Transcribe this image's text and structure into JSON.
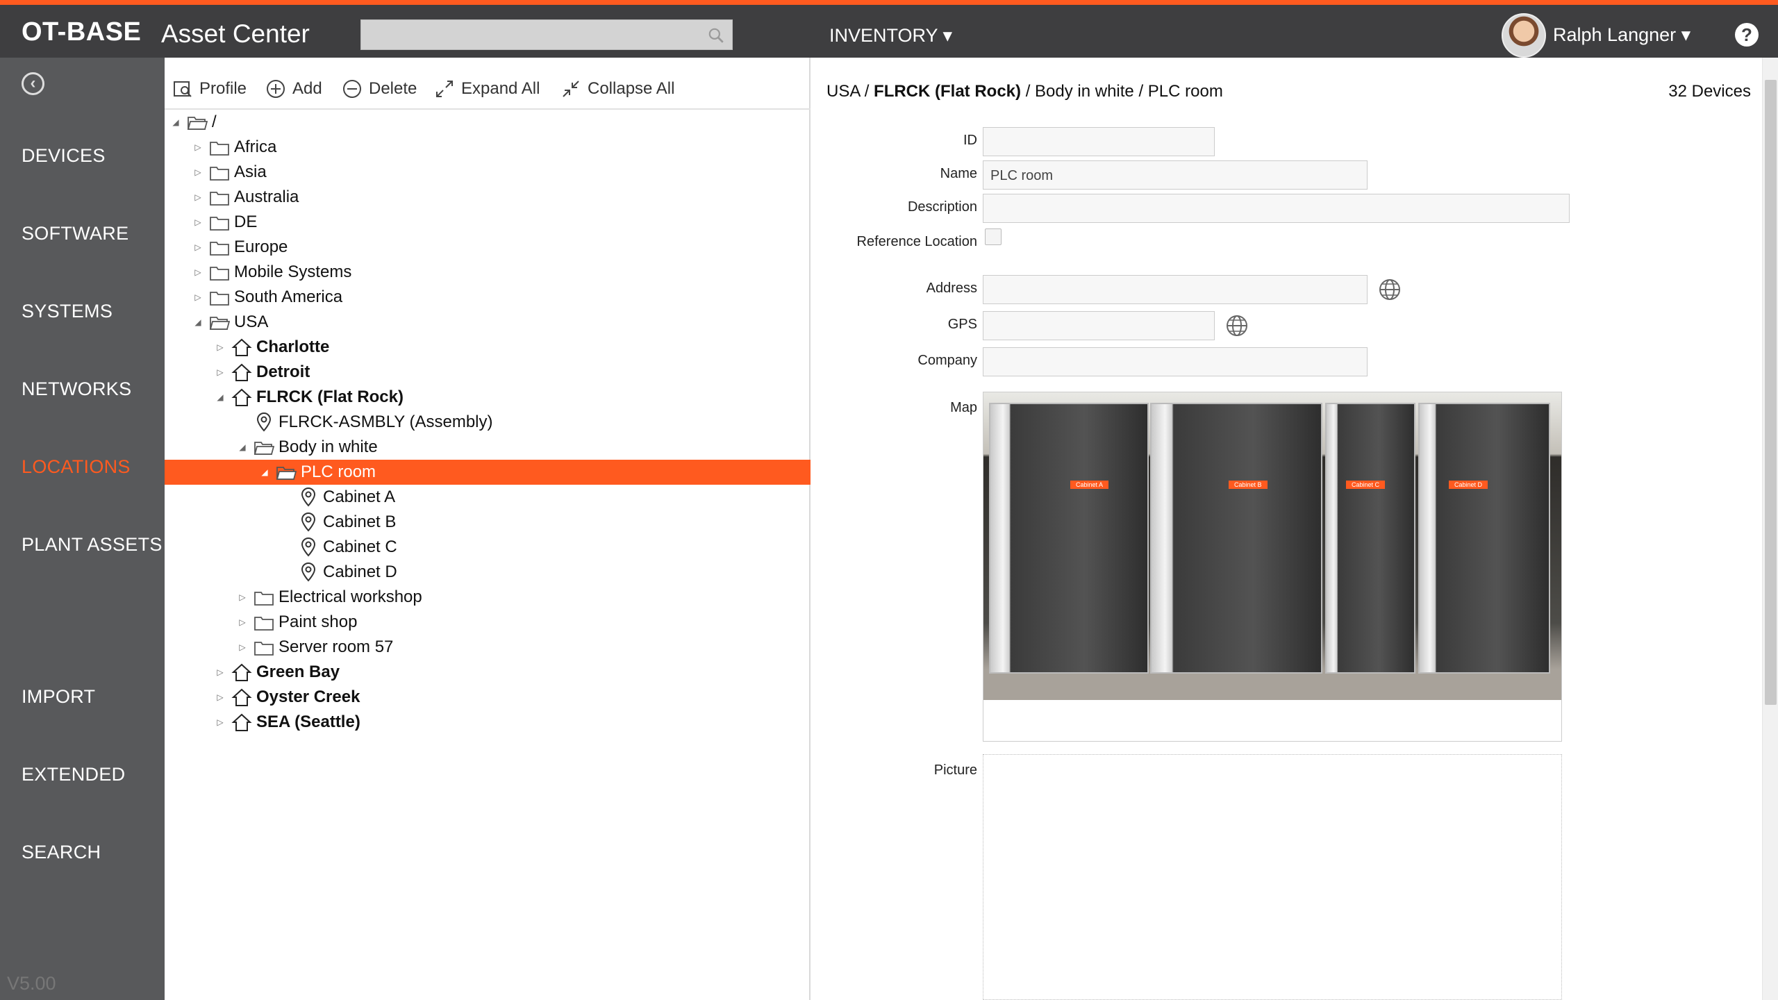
{
  "header": {
    "logo": "OT-BASE",
    "app_title": "Asset Center",
    "search_placeholder": "",
    "inventory_label": "INVENTORY ▾",
    "user_name": "Ralph Langner ▾",
    "help_label": "?"
  },
  "sidebar": {
    "items": [
      {
        "label": "DEVICES",
        "active": false
      },
      {
        "label": "SOFTWARE",
        "active": false
      },
      {
        "label": "SYSTEMS",
        "active": false
      },
      {
        "label": "NETWORKS",
        "active": false
      },
      {
        "label": "LOCATIONS",
        "active": true
      },
      {
        "label": "PLANT ASSETS",
        "active": false
      },
      {
        "label": "IMPORT",
        "active": false
      },
      {
        "label": "EXTENDED",
        "active": false
      },
      {
        "label": "SEARCH",
        "active": false
      }
    ],
    "version": "V5.00"
  },
  "toolbar": {
    "profile": "Profile",
    "add": "Add",
    "delete": "Delete",
    "expand_all": "Expand All",
    "collapse_all": "Collapse All"
  },
  "tree": [
    {
      "label": "/",
      "depth": 0,
      "expander": "expanded",
      "icon": "folder-open-icon",
      "bold": false
    },
    {
      "label": "Africa",
      "depth": 1,
      "expander": "collapsed",
      "icon": "folder-icon",
      "bold": false
    },
    {
      "label": "Asia",
      "depth": 1,
      "expander": "collapsed",
      "icon": "folder-icon",
      "bold": false
    },
    {
      "label": "Australia",
      "depth": 1,
      "expander": "collapsed",
      "icon": "folder-icon",
      "bold": false
    },
    {
      "label": "DE",
      "depth": 1,
      "expander": "collapsed",
      "icon": "folder-icon",
      "bold": false
    },
    {
      "label": "Europe",
      "depth": 1,
      "expander": "collapsed",
      "icon": "folder-icon",
      "bold": false
    },
    {
      "label": "Mobile Systems",
      "depth": 1,
      "expander": "collapsed",
      "icon": "folder-icon",
      "bold": false
    },
    {
      "label": "South America",
      "depth": 1,
      "expander": "collapsed",
      "icon": "folder-icon",
      "bold": false
    },
    {
      "label": "USA",
      "depth": 1,
      "expander": "expanded",
      "icon": "folder-open-icon",
      "bold": false
    },
    {
      "label": "Charlotte",
      "depth": 2,
      "expander": "collapsed",
      "icon": "site-icon",
      "bold": true
    },
    {
      "label": "Detroit",
      "depth": 2,
      "expander": "collapsed",
      "icon": "site-icon",
      "bold": true
    },
    {
      "label": "FLRCK (Flat Rock)",
      "depth": 2,
      "expander": "expanded",
      "icon": "site-icon",
      "bold": true
    },
    {
      "label": "FLRCK-ASMBLY (Assembly)",
      "depth": 3,
      "expander": "none",
      "icon": "pin-icon",
      "bold": false
    },
    {
      "label": "Body in white",
      "depth": 3,
      "expander": "expanded",
      "icon": "folder-open-icon",
      "bold": false
    },
    {
      "label": "PLC room",
      "depth": 4,
      "expander": "expanded",
      "icon": "folder-open-icon",
      "bold": false,
      "selected": true
    },
    {
      "label": "Cabinet A",
      "depth": 5,
      "expander": "none",
      "icon": "pin-icon",
      "bold": false
    },
    {
      "label": "Cabinet B",
      "depth": 5,
      "expander": "none",
      "icon": "pin-icon",
      "bold": false
    },
    {
      "label": "Cabinet C",
      "depth": 5,
      "expander": "none",
      "icon": "pin-icon",
      "bold": false
    },
    {
      "label": "Cabinet D",
      "depth": 5,
      "expander": "none",
      "icon": "pin-icon",
      "bold": false
    },
    {
      "label": "Electrical workshop",
      "depth": 3,
      "expander": "collapsed",
      "icon": "folder-icon",
      "bold": false
    },
    {
      "label": "Paint shop",
      "depth": 3,
      "expander": "collapsed",
      "icon": "folder-icon",
      "bold": false
    },
    {
      "label": "Server room 57",
      "depth": 3,
      "expander": "collapsed",
      "icon": "folder-icon",
      "bold": false
    },
    {
      "label": "Green Bay",
      "depth": 2,
      "expander": "collapsed",
      "icon": "site-icon",
      "bold": true
    },
    {
      "label": "Oyster Creek",
      "depth": 2,
      "expander": "collapsed",
      "icon": "site-icon",
      "bold": true
    },
    {
      "label": "SEA (Seattle)",
      "depth": 2,
      "expander": "collapsed",
      "icon": "site-icon",
      "bold": true
    }
  ],
  "details": {
    "breadcrumb_prefix": "USA / ",
    "breadcrumb_bold": "FLRCK (Flat Rock)",
    "breadcrumb_suffix": " / Body in white / PLC room",
    "device_count": "32 Devices",
    "labels": {
      "id": "ID",
      "name": "Name",
      "description": "Description",
      "reference_location": "Reference Location",
      "address": "Address",
      "gps": "GPS",
      "company": "Company",
      "map": "Map",
      "picture": "Picture"
    },
    "values": {
      "id": "",
      "name": "PLC room",
      "description": "",
      "address": "",
      "gps": "",
      "company": ""
    },
    "map_markers": [
      "Cabinet A",
      "Cabinet B",
      "Cabinet C",
      "Cabinet D"
    ]
  },
  "colors": {
    "accent": "#ff5a1f",
    "topbar": "#3e3e40",
    "sidebar": "#58595b"
  }
}
